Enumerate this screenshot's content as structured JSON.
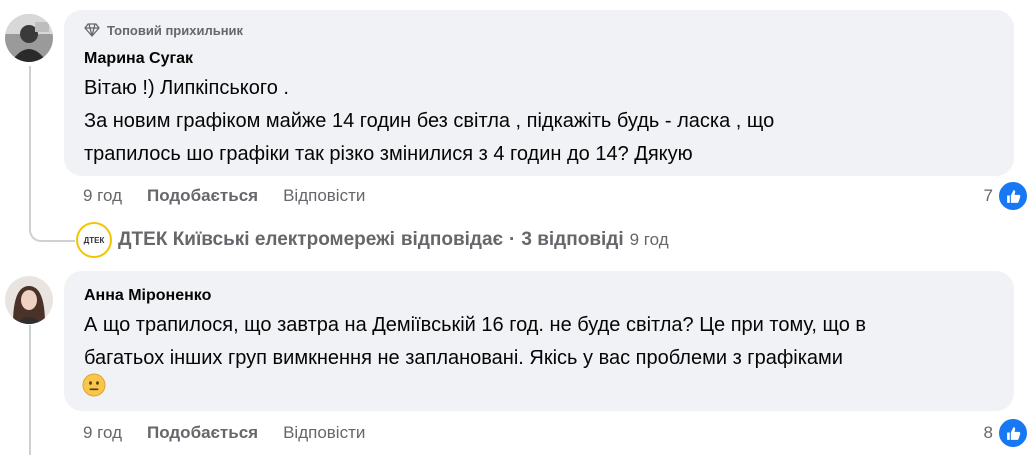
{
  "comment1": {
    "badge": "Топовий прихильник",
    "author": "Марина Сугак",
    "lines": [
      "Вітаю !) Липкіпського .",
      "За новим графіком майже 14 годин без світла , підкажіть будь - ласка , що",
      "трапилось шо графіки так різко змінилися з 4 годин до 14? Дякую"
    ],
    "time": "9 год",
    "like_label": "Подобається",
    "reply_label": "Відповісти",
    "like_count": "7"
  },
  "replies": {
    "author": "ДТЕК Київські електромережі",
    "verb": "відповідає",
    "separator": "·",
    "count": "3 відповіді",
    "time": "9 год",
    "logo_text": "ДТЕК"
  },
  "comment2": {
    "author": "Анна Міроненко",
    "lines": [
      "А що трапилося, що завтра на Деміївській 16 год. не буде світла? Це при тому, що в",
      "багатьох інших груп вимкнення не заплановані. Якісь у вас проблеми з графіками"
    ],
    "time": "9 год",
    "like_label": "Подобається",
    "reply_label": "Відповісти",
    "like_count": "8"
  },
  "colors": {
    "bubble": "#f0f2f5",
    "secondary_text": "#65676b",
    "like_blue": "#1877f2",
    "thread_line": "#ced0d4"
  }
}
